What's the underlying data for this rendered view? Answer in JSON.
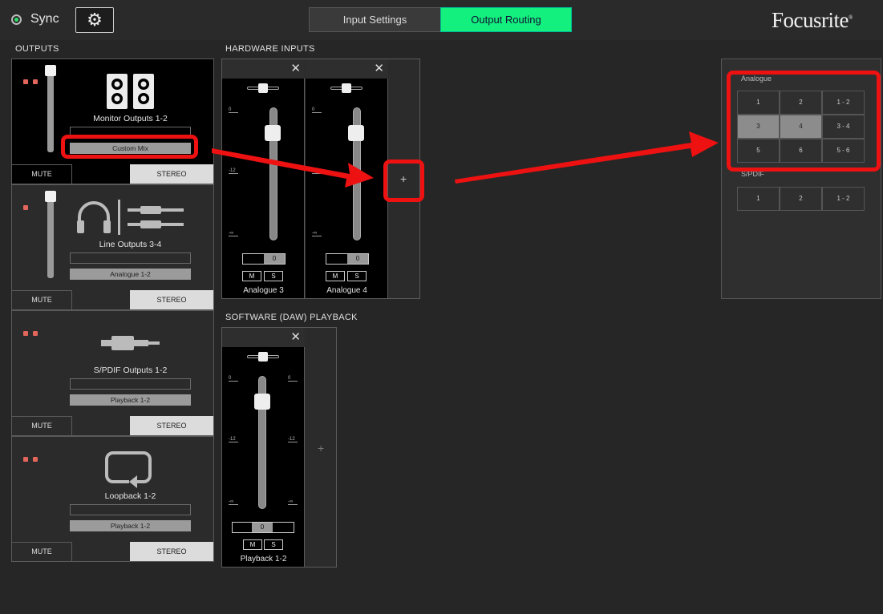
{
  "header": {
    "sync_label": "Sync",
    "tabs": [
      {
        "label": "Input Settings",
        "active": false
      },
      {
        "label": "Output Routing",
        "active": true
      }
    ],
    "logo": "Focusrite",
    "logo_mark": "®",
    "accent_color": "#14f07e"
  },
  "outputs": {
    "title": "OUTPUTS",
    "mute_label": "MUTE",
    "stereo_label": "STEREO",
    "items": [
      {
        "name": "Monitor Outputs 1-2",
        "source": "Custom Mix",
        "icon": "speakers-icon"
      },
      {
        "name": "Line Outputs 3-4",
        "source": "Analogue 1-2",
        "icon": "headphones-icon"
      },
      {
        "name": "S/PDIF Outputs 1-2",
        "source": "Playback 1-2",
        "icon": "spdif-cable-icon"
      },
      {
        "name": "Loopback 1-2",
        "source": "Playback 1-2",
        "icon": "loopback-icon"
      }
    ]
  },
  "hardware_inputs": {
    "title": "HARDWARE INPUTS",
    "strips": [
      {
        "name": "Analogue 3",
        "value": "0"
      },
      {
        "name": "Analogue 4",
        "value": "0"
      }
    ]
  },
  "software_playback": {
    "title": "SOFTWARE (DAW) PLAYBACK",
    "strips": [
      {
        "name": "Playback 1-2",
        "value": "0"
      }
    ]
  },
  "fader_marks": {
    "top": "0",
    "mid": "-12",
    "bottom": "-∞"
  },
  "mute_short": "M",
  "solo_short": "S",
  "add_label": "+",
  "close_label": "✕",
  "routing_panel": {
    "analogue_label": "Analogue",
    "analogue_cells": [
      "1",
      "2",
      "1 - 2",
      "3",
      "4",
      "3 - 4",
      "5",
      "6",
      "5 - 6"
    ],
    "analogue_selected": [
      "3",
      "4"
    ],
    "spdif_label": "S/PDIF",
    "spdif_cells": [
      "1",
      "2",
      "1 - 2"
    ]
  },
  "highlight_color": "#ee1111"
}
